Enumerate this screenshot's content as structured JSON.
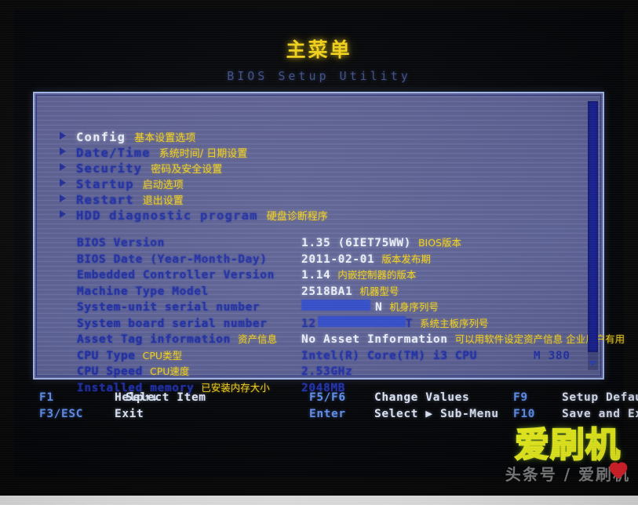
{
  "title": {
    "main": "主菜单",
    "sub": "BIOS Setup Utility"
  },
  "menu": {
    "items": [
      {
        "label": "Config",
        "note": "基本设置选项",
        "selected": true
      },
      {
        "label": "Date/Time",
        "note": "系统时间/ 日期设置",
        "selected": false
      },
      {
        "label": "Security",
        "note": "密码及安全设置",
        "selected": false
      },
      {
        "label": "Startup",
        "note": "启动选项",
        "selected": false
      },
      {
        "label": "Restart",
        "note": "退出设置",
        "selected": false
      },
      {
        "label": "HDD diagnostic program",
        "note": "硬盘诊断程序",
        "selected": false
      }
    ]
  },
  "info": {
    "rows": [
      {
        "label": "BIOS Version",
        "label_note": "",
        "value": "1.35   (6IET75WW)",
        "value_note": "BIOS版本",
        "value_extra": "",
        "dim": false,
        "redacted": false
      },
      {
        "label": "BIOS Date (Year-Month-Day)",
        "label_note": "",
        "value": "2011-02-01",
        "value_note": "版本发布期",
        "value_extra": "",
        "dim": false,
        "redacted": false
      },
      {
        "label": "Embedded Controller Version",
        "label_note": "",
        "value": "1.14",
        "value_note": "内嵌控制器的版本",
        "value_extra": "",
        "dim": false,
        "redacted": false
      },
      {
        "label": "Machine Type Model",
        "label_note": "",
        "value": "2518BA1",
        "value_note": "机器型号",
        "value_extra": "",
        "dim": false,
        "redacted": false
      },
      {
        "label": "System-unit serial number",
        "label_note": "",
        "value": "N",
        "value_note": "机身序列号",
        "value_extra": "",
        "dim": false,
        "redacted": true,
        "redaction_style": "lead"
      },
      {
        "label": "System board serial number",
        "label_note": "",
        "value": "12",
        "value_note": "系统主板序列号",
        "value_extra": "",
        "dim": true,
        "redacted": true,
        "redaction_style": "mid"
      },
      {
        "label": "Asset Tag information",
        "label_note": "资产信息",
        "value": "No Asset Information",
        "value_note": "可以用软件设定资产信息 企业用户有用",
        "value_extra": "",
        "dim": false,
        "redacted": false
      },
      {
        "label": "CPU Type",
        "label_note": "CPU类型",
        "value": "Intel(R) Core(TM) i3 CPU",
        "value_note": "",
        "value_extra": "M 380",
        "dim": true,
        "redacted": false
      },
      {
        "label": "CPU Speed",
        "label_note": "CPU速度",
        "value": "2.53GHz",
        "value_note": "",
        "value_extra": "",
        "dim": true,
        "redacted": false
      },
      {
        "label": "Installed memory",
        "label_note": "已安装内存大小",
        "value": "2048MB",
        "value_note": "",
        "value_extra": "",
        "dim": true,
        "redacted": false
      }
    ]
  },
  "footer": {
    "columns": [
      {
        "lines": [
          {
            "key": "F1",
            "desc": "Help↑↓"
          },
          {
            "key": "F3/ESC",
            "desc": "Exit"
          }
        ]
      },
      {
        "lines": [
          {
            "key": "",
            "desc": "Select Item"
          },
          {
            "key": "",
            "desc": ""
          }
        ]
      },
      {
        "lines": [
          {
            "key": "F5/F6",
            "desc": "Change Values"
          },
          {
            "key": "Enter",
            "desc": "Select ▶ Sub-Menu"
          }
        ]
      },
      {
        "lines": [
          {
            "key": "F9",
            "desc": "Setup Defaults"
          },
          {
            "key": "F10",
            "desc": "Save and Exit"
          }
        ]
      }
    ]
  },
  "watermark": {
    "main": "爱刷机",
    "sub": "头条号 / 爱刷机"
  },
  "colors": {
    "panel_bg": "#5a5f93",
    "title_yellow": "#f3d117",
    "label_blue": "#1b2aa2",
    "value_white": "#ecf0fa",
    "fkey_blue": "#5f8ff0",
    "watermark_green": "#b7f03c",
    "redaction_blue": "#2f49c8"
  }
}
